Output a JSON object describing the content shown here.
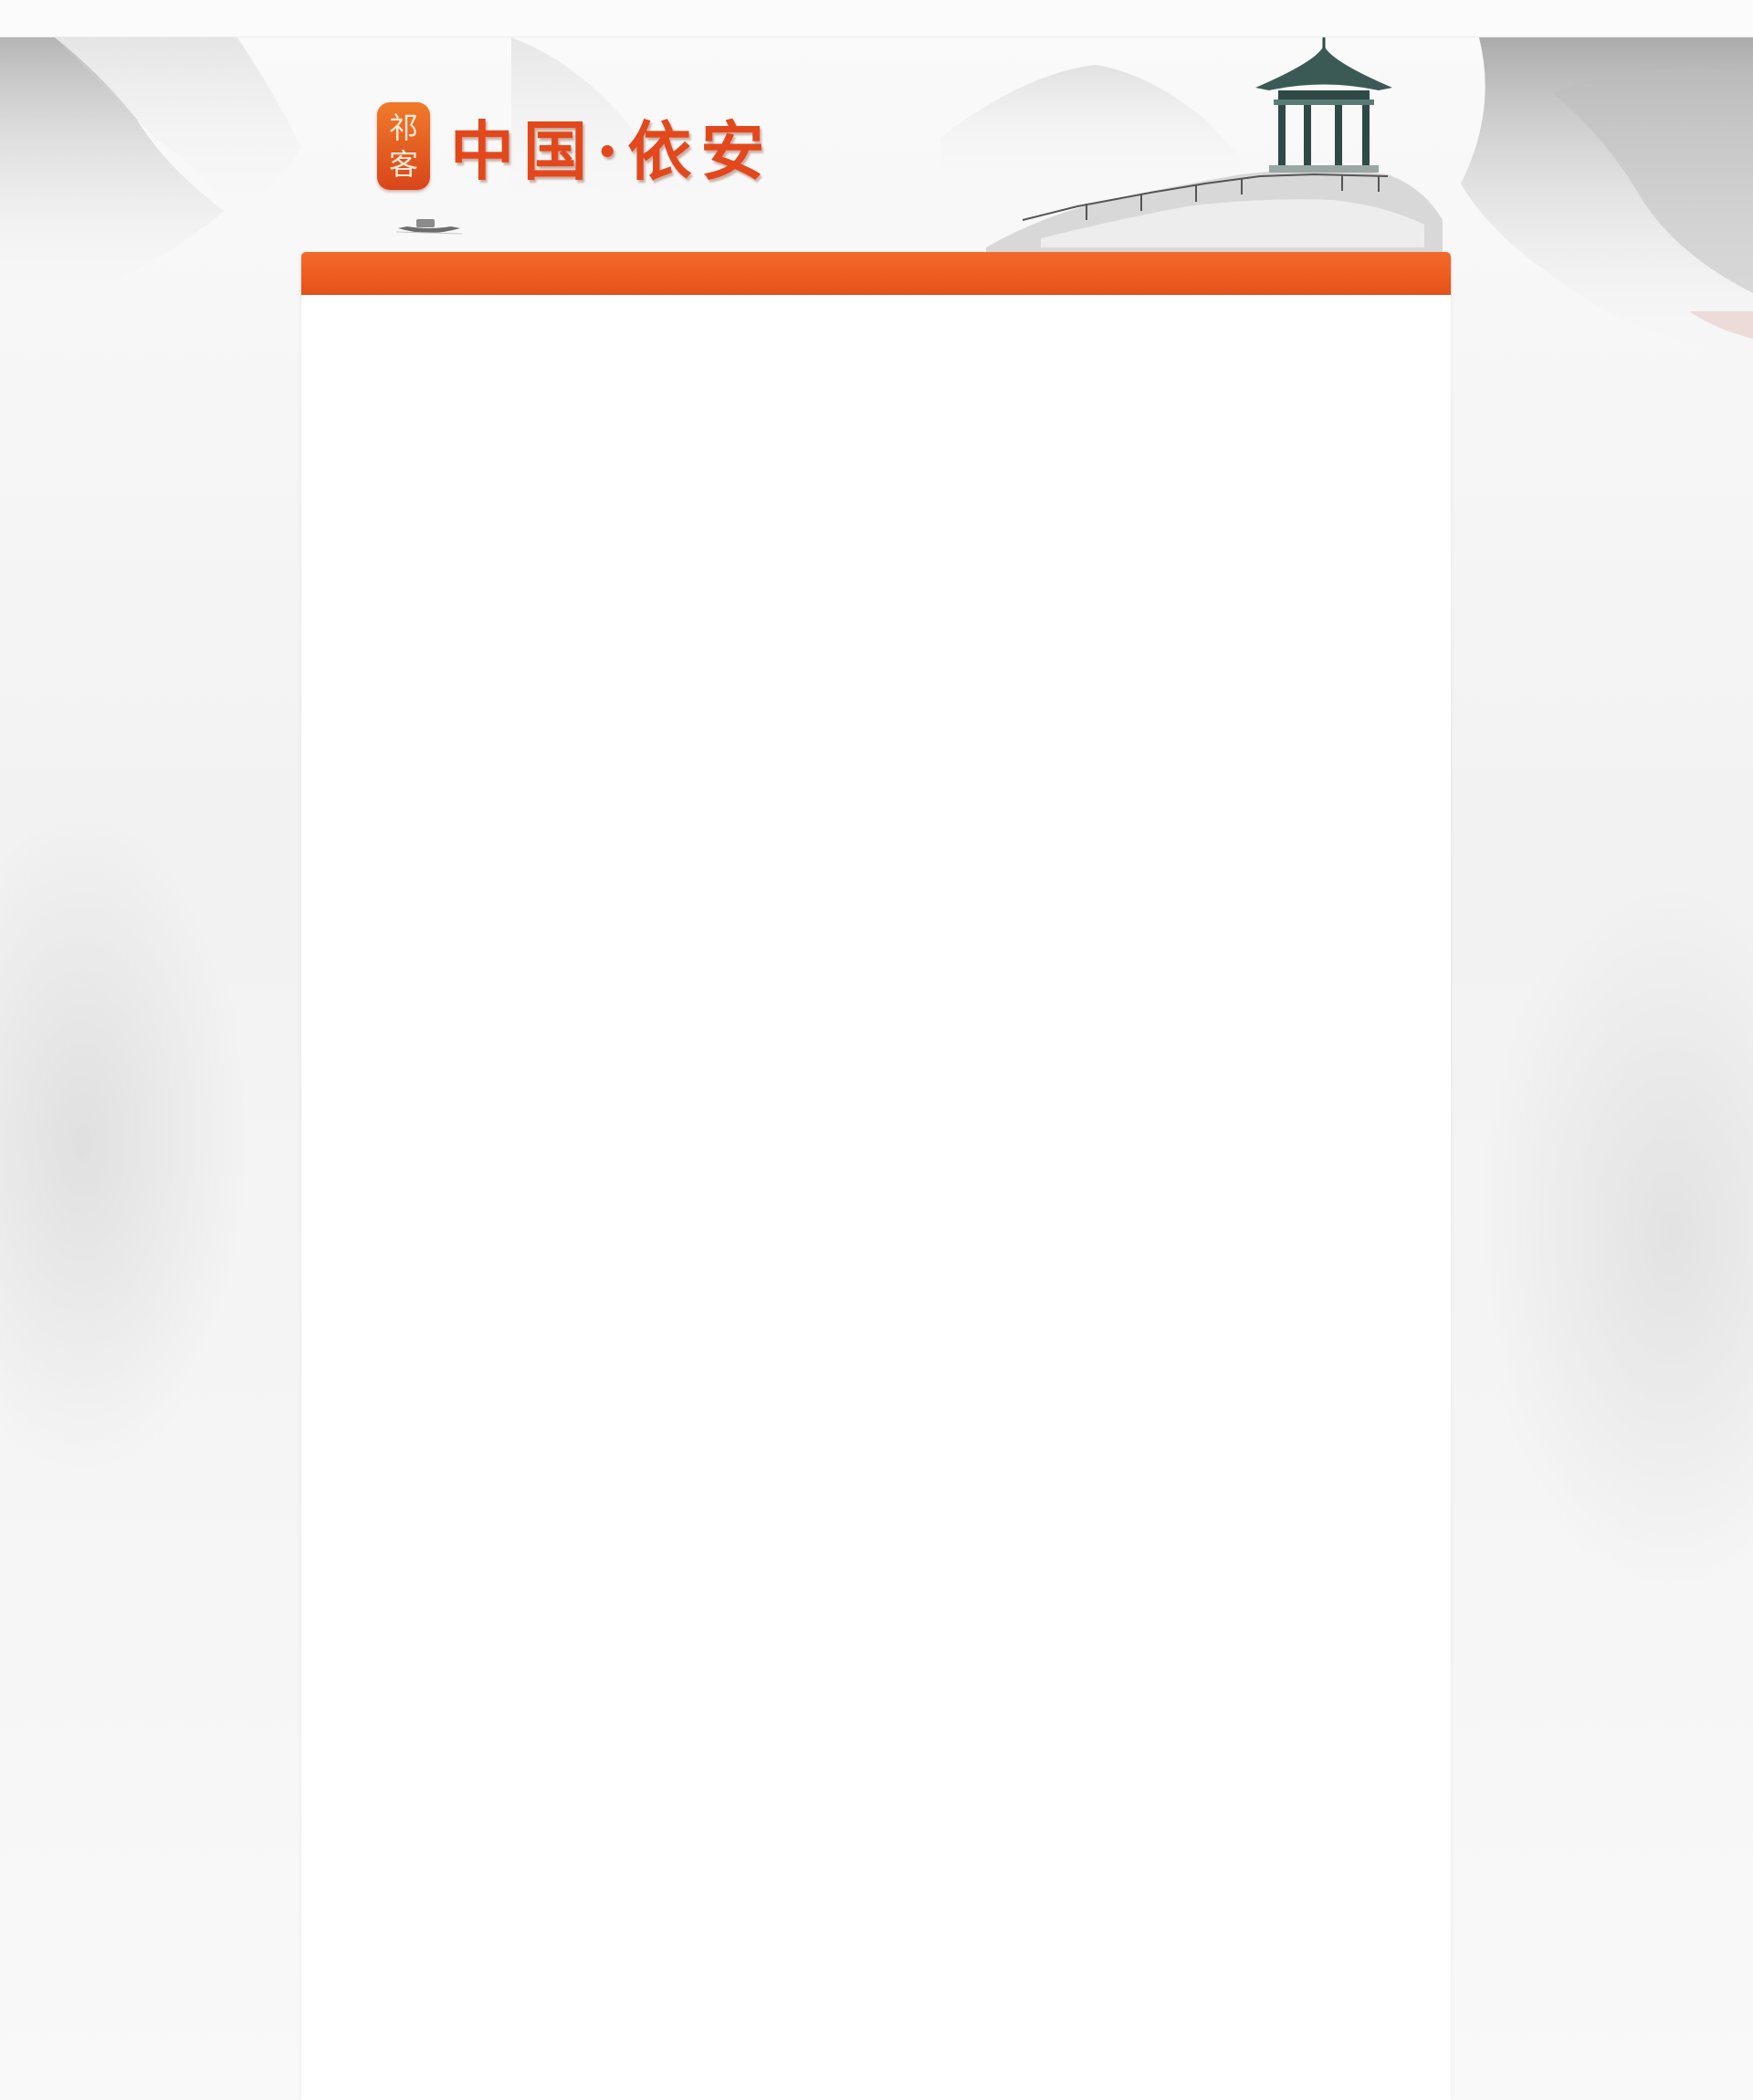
{
  "logo": {
    "seal_top": "祁",
    "seal_bottom": "客",
    "title": "中国·依安"
  },
  "colors": {
    "accent": "#ee5c20",
    "accent_dark": "#e4531b",
    "page_background": "#f6f6f6",
    "panel_background": "#ffffff"
  },
  "icons": {
    "pavilion": "pavilion-icon",
    "boat": "boat-icon"
  }
}
